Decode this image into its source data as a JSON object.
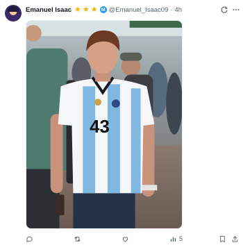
{
  "post": {
    "author_name": "Emanuel Isaac",
    "badge_letter": "M",
    "handle": "@Emanuel_Isaac09",
    "separator": "·",
    "time": "4h",
    "stars": [
      "★",
      "★",
      "★"
    ],
    "icons": {
      "header_right": [
        "grok-icon",
        "more-icon"
      ],
      "actions": [
        "reply-icon",
        "repost-icon",
        "like-icon",
        "views-icon",
        "bookmark-icon",
        "share-icon"
      ]
    },
    "photo": {
      "jersey_number": "43"
    },
    "actions": {
      "views_count": "5"
    },
    "colors": {
      "accent": "#1d9bf0",
      "star": "#f5b301",
      "muted": "#536471"
    }
  }
}
